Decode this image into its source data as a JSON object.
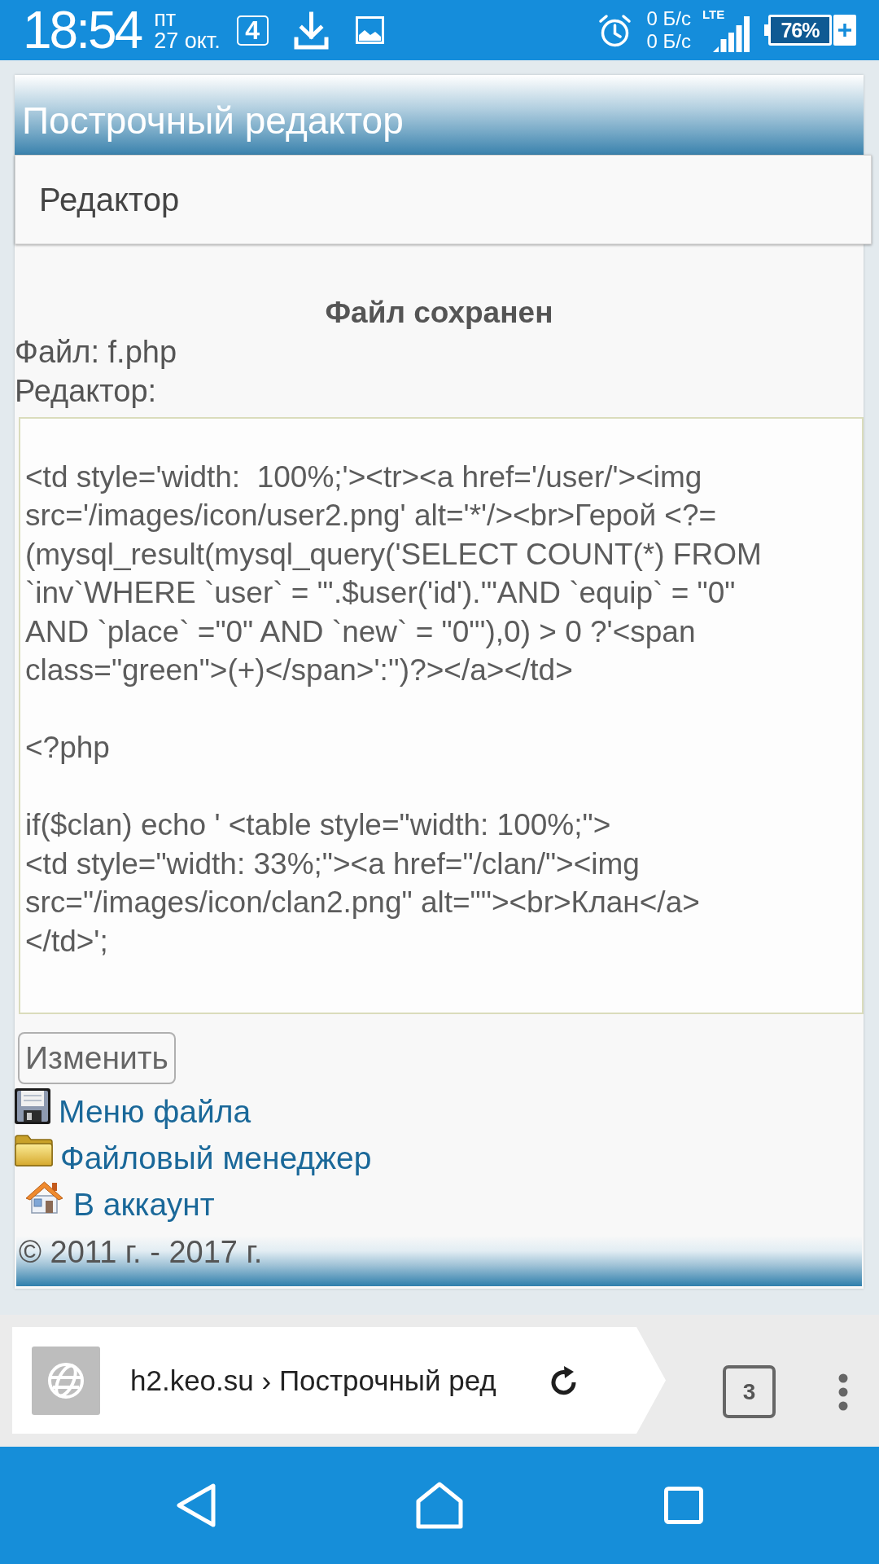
{
  "status_bar": {
    "time": "18:54",
    "weekday": "пт",
    "date": "27 окт.",
    "notification_logo": "4",
    "network_speeds": [
      "0 Б/с",
      "0 Б/с"
    ],
    "network_type": "LTE",
    "battery": "76%"
  },
  "page": {
    "title": "Построчный редактор",
    "section": "Редактор",
    "notice": "Файл сохранен",
    "file_label": "Файл: f.php",
    "editor_label": "Редактор:",
    "editor": {
      "value": "\n<td style='width:  100%;'><tr><a href='/user/'><img\nsrc='/images/icon/user2.png' alt='*'/><br>Герой <?=\n(mysql_result(mysql_query('SELECT COUNT(*) FROM\n`inv`WHERE `user` = \"'.$user('id').'\"AND `equip` = \"0\"\nAND `place` =\"0\" AND `new` = \"0\"'),0) > 0 ?'<span\nclass=\"green\">(+)</span>':'')?></a></td>\n\n<?php\n\nif($clan) echo ' <table style=\"width: 100%;\">\n<td style=\"width: 33%;\"><a href=\"/clan/\"><img\nsrc=\"/images/icon/clan2.png\" alt=\"\"><br>Клан</a>\n</td>';"
    },
    "submit_button": "Изменить",
    "links": [
      {
        "label": "Меню файла",
        "kind": "floppy"
      },
      {
        "label": "Файловый менеджер",
        "kind": "folder"
      },
      {
        "label": "В аккаунт",
        "kind": "house"
      }
    ],
    "footer": "© 2011 г. - 2017 г."
  },
  "browser_bar": {
    "url": "h2.keo.su › Построчный ред",
    "tab_count": "3"
  }
}
